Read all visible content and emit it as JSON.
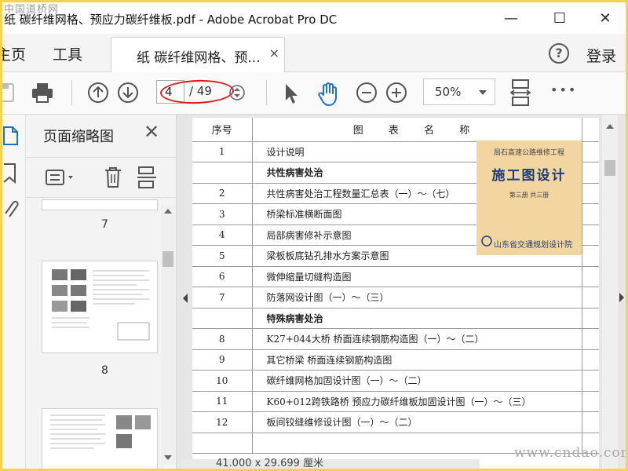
{
  "window": {
    "site_watermark_top": "中国道桥网",
    "title": "纸  碳纤维网格、预应力碳纤维板.pdf - Adobe Acrobat Pro DC",
    "controls": {
      "minimize": "—",
      "maximize": "☐",
      "close": "✕"
    }
  },
  "menubar": {
    "home": "主页",
    "tools": "工具",
    "tab_label": "纸  碳纤维网格、预...",
    "tab_close": "×",
    "help": "?",
    "login": "登录"
  },
  "toolbar": {
    "current_page": "4",
    "total_pages": "/ 49",
    "zoom": "50%",
    "more": "•••"
  },
  "thumbnails": {
    "title": "页面缩略图",
    "close": "✕",
    "pages": [
      {
        "label": "7"
      },
      {
        "label": "8"
      }
    ]
  },
  "document": {
    "header": {
      "no": "序号",
      "name": "图 表 名 称"
    },
    "rows": [
      {
        "no": "1",
        "name": "设计说明",
        "bold": false
      },
      {
        "no": "",
        "name": "共性病害处治",
        "bold": true
      },
      {
        "no": "2",
        "name": "共性病害处治工程数量汇总表（一）～（七）",
        "bold": false
      },
      {
        "no": "3",
        "name": "桥梁标准横断面图",
        "bold": false
      },
      {
        "no": "4",
        "name": "局部病害修补示意图",
        "bold": false
      },
      {
        "no": "5",
        "name": "梁板板底钻孔排水方案示意图",
        "bold": false
      },
      {
        "no": "6",
        "name": "微伸缩量切缝构造图",
        "bold": false
      },
      {
        "no": "7",
        "name": "防落网设计图（一）～（三）",
        "bold": false
      },
      {
        "no": "",
        "name": "特殊病害处治",
        "bold": true
      },
      {
        "no": "8",
        "name": "K27+044大桥 桥面连续钢筋构造图（一）～（二）",
        "bold": false
      },
      {
        "no": "9",
        "name": "其它桥梁 桥面连续钢筋构造图",
        "bold": false
      },
      {
        "no": "10",
        "name": "碳纤维网格加固设计图（一）～（二）",
        "bold": false
      },
      {
        "no": "11",
        "name": "K60+012跨铁路桥 预应力碳纤维板加固设计图（一）～（三）",
        "bold": false
      },
      {
        "no": "12",
        "name": "板间铰缝维修设计图（一）～（二）",
        "bold": false
      },
      {
        "no": "",
        "name": "",
        "bold": false
      }
    ],
    "cover": {
      "top": "局石高速公路维修工程",
      "big": "施工图设计",
      "small": "第三册 共三册",
      "org": "山东省交通规划设计院"
    }
  },
  "status": {
    "page_size": "41.000 x 29.699 厘米"
  },
  "footer": {
    "watermark": "www.cndao.com"
  },
  "colors": {
    "border_frame": "#f5d34a",
    "hand_tool_active": "#1a6fd1",
    "highlight_ring": "#d62020"
  }
}
